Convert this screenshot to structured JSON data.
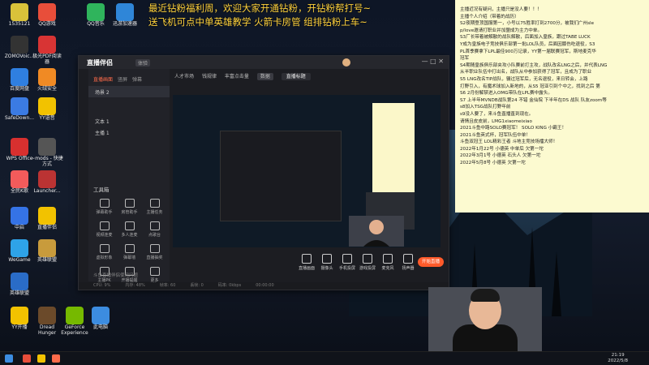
{
  "headline": {
    "line1": "最近钻粉福利周，欢迎大家开通钻粉，开钻粉帮打号~",
    "line2": "送飞机可点中单英雄教学 火箭卡房管  组排钻粉上车~"
  },
  "desktop_icons": [
    {
      "label": "1535121",
      "color": "#d9c23a"
    },
    {
      "label": "QQ游戏",
      "color": "#e84e3a"
    },
    {
      "label": "QQ音乐",
      "color": "#2fb45c"
    },
    {
      "label": "迅游加速器",
      "color": "#2f86d8"
    },
    {
      "label": "ZOMOVoic...",
      "color": "#333"
    },
    {
      "label": "极光PDF阅读器",
      "color": "#d83434"
    },
    {
      "label": "百度网盘",
      "color": "#2f7fe0"
    },
    {
      "label": "火绒安全",
      "color": "#f08a24"
    },
    {
      "label": "SafeDown...",
      "color": "#3b7be3"
    },
    {
      "label": "YY语音",
      "color": "#f2c200"
    },
    {
      "label": "WPS Office",
      "color": "#d8302f"
    },
    {
      "label": "~mods - 快捷方式",
      "color": "#555"
    },
    {
      "label": "全民K歌",
      "color": "#f35b5b"
    },
    {
      "label": "Launcher...",
      "color": "#b33"
    },
    {
      "label": "中启",
      "color": "#3573e6"
    },
    {
      "label": "直播伴侣",
      "color": "#f2c200"
    },
    {
      "label": "WeGame",
      "color": "#2ea3e8"
    },
    {
      "label": "英雄联盟",
      "color": "#c89b3c"
    },
    {
      "label": "英雄联盟",
      "color": "#2a6cc7"
    },
    {
      "label": "YY开播",
      "color": "#f2c200"
    },
    {
      "label": "Dread Hunger",
      "color": "#6b4a2a"
    },
    {
      "label": "GeForce Experience",
      "color": "#76b900"
    },
    {
      "label": "此电脑",
      "color": "#3c8ce0"
    }
  ],
  "app": {
    "logo": "直播伴侣",
    "version": "体验",
    "controls": "—  □  ✕",
    "tabs": [
      "直播画面",
      "竖屏",
      "弹幕"
    ],
    "scenes": [
      "场景 2",
      "文本 1",
      "主播 1"
    ],
    "tools_title": "工具箱",
    "tools": [
      "弹幕助手",
      "房管助手",
      "主播任务",
      "视频连麦",
      "多人连麦",
      "点歌台",
      "虚拟形象",
      "弹幕墙",
      "直播抽奖",
      "主播PK",
      "开播提醒",
      "更多"
    ],
    "bottom_note": "斗鱼直播伴侣使用问题",
    "info": {
      "item1": "人才市场",
      "item2": "钱规律",
      "item3": "丰富点击量",
      "tag": "数据",
      "field": "直播标题"
    },
    "bottom_bar": [
      "直播画面",
      "摄像头",
      "手机投屏",
      "游戏投屏",
      "麦克风",
      "扬声器"
    ],
    "go_live": "开始直播",
    "status": [
      "CPU: 9%",
      "内存: 48%",
      "帧率: 60",
      "丢帧: 0",
      "码率: 0kbps",
      "00:00:00"
    ]
  },
  "notes": [
    "主播近况有疑问，主播只是没人要！！！",
    "主播个人介绍（带着的战历）",
    "S2夜期登顶国服第一，小号以75胜率打到2700分，被我们广州sle",
    "p/love邀请打职业并加盟成为主力中单。",
    "S3厂长带着被解散的战队解散，后面加入皇族，跟过TABE LUCK",
    "Y成为皇族电子竞技俱乐部第一批LOL队员，后面因膝伤吃退役，S3",
    "PL首季赛拿下LPL最佳900万记录，YY第一届联赛冠军，斯地麦克华",
    "冠军",
    "S4期随皇族俱乐部夹攻小队赛前打主攻，战队改名LNG之后，并代表LNG",
    "从半职业队伍中打出名，战队从中参加获得了冠军，且成为了职业",
    "S5 LNG改名TIP战队，辗过冠军后，无名退役，来日转会，上路",
    "打野引入，有魔术球加入新地的，从S5 冠亚引到个中之，找到之后 第",
    "S6 2月份解禁进入OMG带队在LPL赛中露头。",
    "S7 上半年MVNDB战队第24 不错 金仙院 下半年在DS 战队 队友zoom等",
    "s8加入TSG战队打野年前",
    "s9没人要了，来斗鱼直播直到现在。",
    "请情且皮皮前，LMG1xiaomeixiao",
    "2021斗鱼中路SOLO赛冠军！ SOLO KING 小霸王！",
    "2021斗鱼英式杯，冠军队伍中单！",
    "斗鱼双冠王 LOL精彩王者 斗地主竞技场擂大师！",
    "2022年1月22号  小德英 中单后 欠第一坨",
    "2022年3月1号  小德英  石头人 欠第一坨",
    "2022年5月8号  小德英 欠第一坨"
  ],
  "taskbar": {
    "time": "21:19",
    "date": "2022/5/8"
  }
}
